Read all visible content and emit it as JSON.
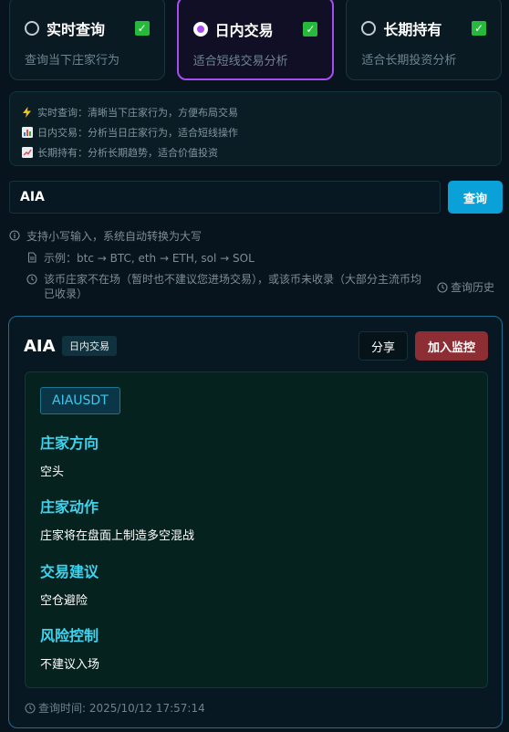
{
  "modes": [
    {
      "label": "实时查询",
      "desc": "查询当下庄家行为",
      "selected": false,
      "checked": true
    },
    {
      "label": "日内交易",
      "desc": "适合短线交易分析",
      "selected": true,
      "checked": true
    },
    {
      "label": "长期持有",
      "desc": "适合长期投资分析",
      "selected": false,
      "checked": true
    }
  ],
  "info": {
    "lines": [
      {
        "icon": "lightning-icon",
        "text": "实时查询：清晰当下庄家行为，方便布局交易"
      },
      {
        "icon": "bar-chart-icon",
        "text": "日内交易：分析当日庄家行为，适合短线操作"
      },
      {
        "icon": "trend-up-icon",
        "text": "长期持有：分析长期趋势，适合价值投资"
      }
    ]
  },
  "search": {
    "value": "AIA",
    "button_label": "查询"
  },
  "hints": {
    "uppercase": "支持小写输入，系统自动转换为大写",
    "example": "示例：btc → BTC, eth → ETH, sol → SOL",
    "warning_line1": "该币庄家不在场（暂时也不建议您进场交易），或该币未收录（大部分主流币均",
    "warning_line2": "已收录）",
    "history_label": "查询历史"
  },
  "result": {
    "symbol": "AIA",
    "mode_tag": "日内交易",
    "share_label": "分享",
    "monitor_label": "加入监控",
    "pair": "AIAUSDT",
    "sections": [
      {
        "title": "庄家方向",
        "body": "空头"
      },
      {
        "title": "庄家动作",
        "body": "庄家将在盘面上制造多空混战"
      },
      {
        "title": "交易建议",
        "body": "空仓避险"
      },
      {
        "title": "风险控制",
        "body": "不建议入场"
      }
    ],
    "query_time": "查询时间: 2025/10/12 17:57:14"
  },
  "colors": {
    "background": "#07141d",
    "accent_purple": "#a84df0",
    "accent_blue": "#0aa0d8",
    "danger": "#8d2d34",
    "section_title": "#3ed4f0",
    "check_green": "#27b93b"
  }
}
